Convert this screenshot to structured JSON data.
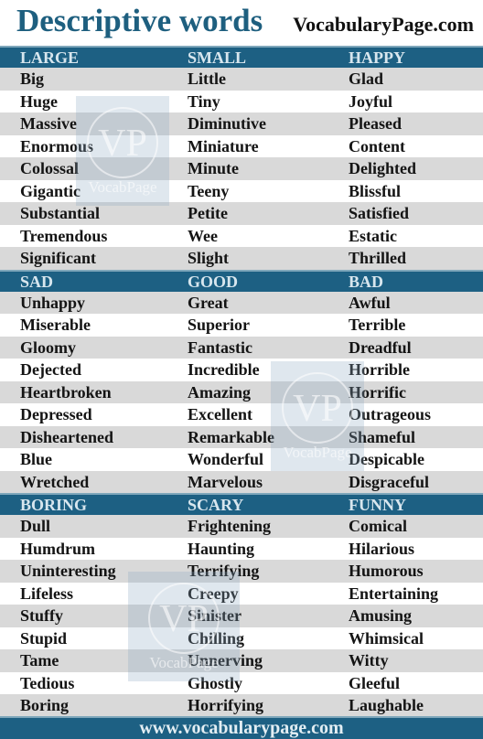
{
  "header": {
    "title": "Descriptive words",
    "site": "VocabularyPage.com"
  },
  "watermark": {
    "logo": "VP",
    "text": "VocabPage"
  },
  "colors": {
    "header_band": "#1d6083",
    "stripe": "#d9d9d9",
    "title": "#1e5f7f"
  },
  "sections": [
    {
      "headers": [
        "LARGE",
        "SMALL",
        "HAPPY"
      ],
      "rows": [
        [
          "Big",
          "Little",
          "Glad"
        ],
        [
          "Huge",
          "Tiny",
          "Joyful"
        ],
        [
          "Massive",
          "Diminutive",
          "Pleased"
        ],
        [
          "Enormous",
          "Miniature",
          "Content"
        ],
        [
          "Colossal",
          "Minute",
          "Delighted"
        ],
        [
          "Gigantic",
          "Teeny",
          "Blissful"
        ],
        [
          "Substantial",
          "Petite",
          "Satisfied"
        ],
        [
          "Tremendous",
          "Wee",
          "Estatic"
        ],
        [
          "Significant",
          "Slight",
          "Thrilled"
        ]
      ]
    },
    {
      "headers": [
        "SAD",
        "GOOD",
        "BAD"
      ],
      "rows": [
        [
          "Unhappy",
          "Great",
          "Awful"
        ],
        [
          "Miserable",
          "Superior",
          "Terrible"
        ],
        [
          "Gloomy",
          "Fantastic",
          "Dreadful"
        ],
        [
          "Dejected",
          "Incredible",
          "Horrible"
        ],
        [
          "Heartbroken",
          "Amazing",
          "Horrific"
        ],
        [
          "Depressed",
          "Excellent",
          "Outrageous"
        ],
        [
          "Disheartened",
          "Remarkable",
          "Shameful"
        ],
        [
          "Blue",
          "Wonderful",
          "Despicable"
        ],
        [
          "Wretched",
          "Marvelous",
          "Disgraceful"
        ]
      ]
    },
    {
      "headers": [
        "BORING",
        "SCARY",
        "FUNNY"
      ],
      "rows": [
        [
          "Dull",
          "Frightening",
          "Comical"
        ],
        [
          "Humdrum",
          "Haunting",
          "Hilarious"
        ],
        [
          "Uninteresting",
          "Terrifying",
          "Humorous"
        ],
        [
          "Lifeless",
          "Creepy",
          "Entertaining"
        ],
        [
          "Stuffy",
          "Sinister",
          "Amusing"
        ],
        [
          "Stupid",
          "Chilling",
          "Whimsical"
        ],
        [
          "Tame",
          "Unnerving",
          "Witty"
        ],
        [
          "Tedious",
          "Ghostly",
          "Gleeful"
        ],
        [
          "Boring",
          "Horrifying",
          "Laughable"
        ]
      ]
    }
  ],
  "footer": {
    "url": "www.vocabularypage.com"
  }
}
